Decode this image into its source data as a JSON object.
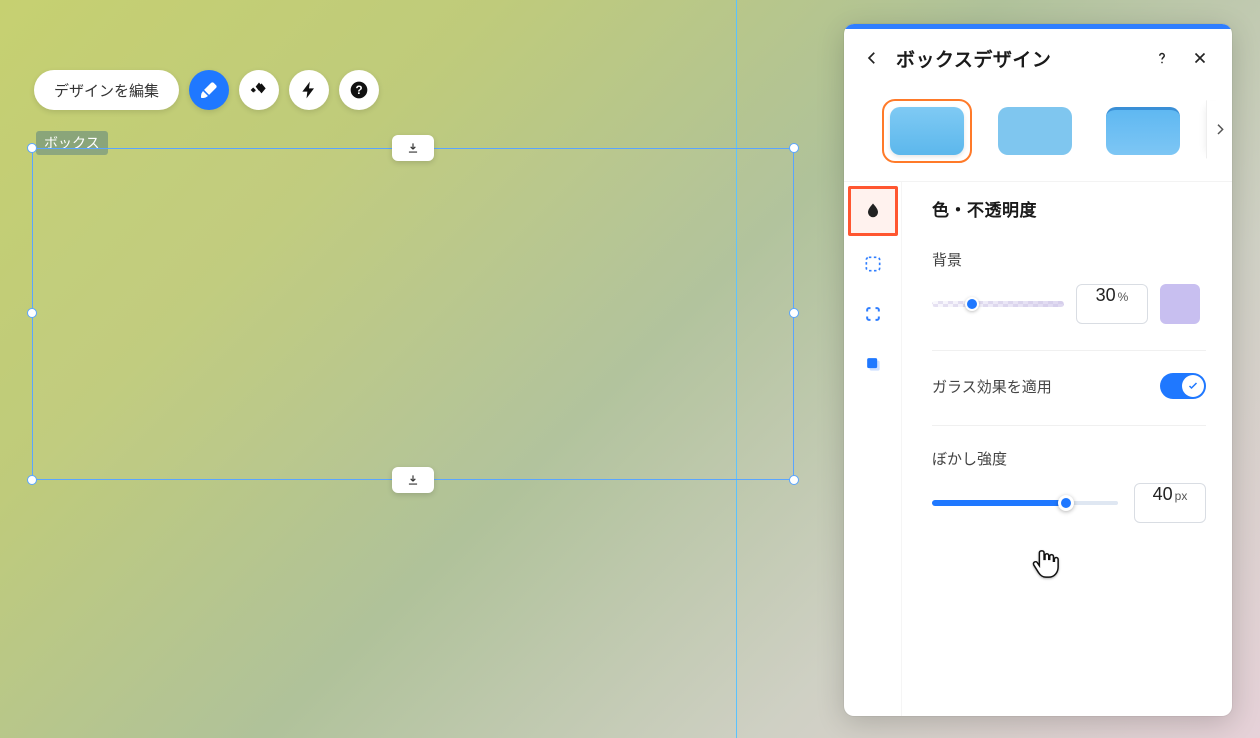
{
  "toolbar": {
    "edit_label": "デザインを編集"
  },
  "canvas": {
    "box_label": "ボックス"
  },
  "panel": {
    "title": "ボックスデザイン",
    "section_title": "色・不透明度",
    "background": {
      "label": "背景",
      "value": "30",
      "unit": "%",
      "swatch_color": "#c8bff0",
      "percent": 30
    },
    "glass": {
      "label": "ガラス効果を適用",
      "on": true
    },
    "blur": {
      "label": "ぼかし強度",
      "value": "40",
      "unit": "px",
      "percent": 72
    }
  }
}
